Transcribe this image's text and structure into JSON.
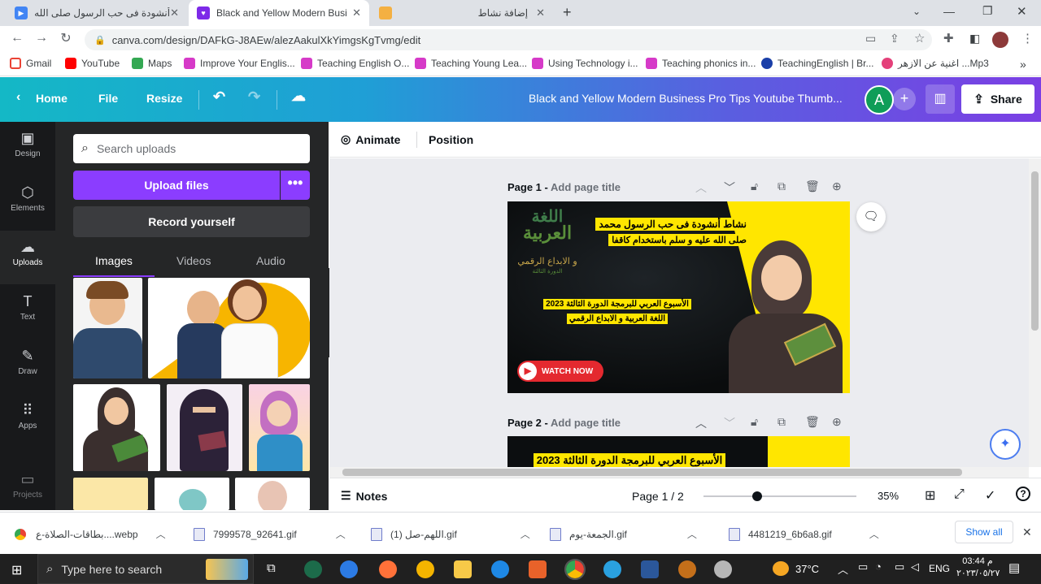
{
  "browser": {
    "tabs": [
      {
        "title": "أنشودة فى حب الرسول صلى الله عل...",
        "active": false
      },
      {
        "title": "Black and Yellow Modern Busine",
        "active": true
      },
      {
        "title": "",
        "active": false
      },
      {
        "title": "إضافة نشاط",
        "active": false
      }
    ],
    "new_tab_label": "+",
    "url": "canva.com/design/DAFkG-J8AEw/alezAakulXkYimgsKgTvmg/edit",
    "bookmarks": [
      {
        "label": "Gmail",
        "color": "#ea4335"
      },
      {
        "label": "YouTube",
        "color": "#ff0000"
      },
      {
        "label": "Maps",
        "color": "#34a853"
      },
      {
        "label": "Improve Your Englis...",
        "color": "#d63ac8"
      },
      {
        "label": "Teaching English O...",
        "color": "#d63ac8"
      },
      {
        "label": "Teaching Young Lea...",
        "color": "#d63ac8"
      },
      {
        "label": "Using Technology i...",
        "color": "#d63ac8"
      },
      {
        "label": "Teaching phonics in...",
        "color": "#d63ac8"
      },
      {
        "label": "TeachingEnglish | Br...",
        "color": "#1a3fa8"
      },
      {
        "label": "اغنية عن الازهر ...Mp3",
        "color": "#e4407a"
      }
    ],
    "more_bookmarks": "»"
  },
  "canva": {
    "header": {
      "home": "Home",
      "file": "File",
      "resize": "Resize",
      "doc_title": "Black and Yellow Modern Business Pro Tips Youtube Thumb...",
      "avatar_letter": "A",
      "share": "Share"
    },
    "sidebar": [
      {
        "label": "Design",
        "icon": "layout-icon"
      },
      {
        "label": "Elements",
        "icon": "shapes-icon"
      },
      {
        "label": "Uploads",
        "icon": "cloud-upload-icon",
        "active": true
      },
      {
        "label": "Text",
        "icon": "text-icon"
      },
      {
        "label": "Draw",
        "icon": "draw-icon"
      },
      {
        "label": "Apps",
        "icon": "apps-grid-icon"
      },
      {
        "label": "Projects",
        "icon": "folder-icon"
      }
    ],
    "panel": {
      "search_placeholder": "Search uploads",
      "upload_button": "Upload files",
      "upload_more": "•••",
      "record_button": "Record yourself",
      "tabs": [
        "Images",
        "Videos",
        "Audio"
      ]
    },
    "toolbar": {
      "animate": "Animate",
      "position": "Position"
    },
    "pages": [
      {
        "label": "Page 1 - ",
        "title_placeholder": "Add page title"
      },
      {
        "label": "Page 2 - ",
        "title_placeholder": "Add page title"
      }
    ],
    "design1": {
      "headline_line1": "نشاط أنشودة فى حب الرسول محمد",
      "headline_line2": "صلى الله عليه و سلم  باستخدام كاقفا",
      "logo_line1": "اللغة",
      "logo_line2": "العربية",
      "logo_line3": "و الابداع الرقمي",
      "logo_line4": "الدورة الثالثة",
      "sub_line1": "الأسبوع العربي للبرمجة الدورة الثالثة 2023",
      "sub_line2": "اللغة العربية و الابداع الرقمي",
      "watch_now": "WATCH NOW"
    },
    "design2": {
      "sub_line1": "الأسبوع العربي للبرمجة الدورة الثالثة 2023"
    },
    "footer": {
      "notes": "Notes",
      "page_indicator": "Page 1 / 2",
      "zoom": "35%",
      "zoom_fraction": 0.35
    }
  },
  "downloads": {
    "items": [
      "بطاقات-الصلاة-ع....webp",
      "7999578_92641.gif",
      "اللهم-صل (1).gif",
      "الجمعة-يوم.gif",
      "4481219_6b6a8.gif"
    ],
    "show_all": "Show all"
  },
  "taskbar": {
    "search_placeholder": "Type here to search",
    "weather": "37°C",
    "language": "ENG",
    "time": "03:44 م",
    "date": "٢٠٢٣/٠٥/٢٧"
  }
}
